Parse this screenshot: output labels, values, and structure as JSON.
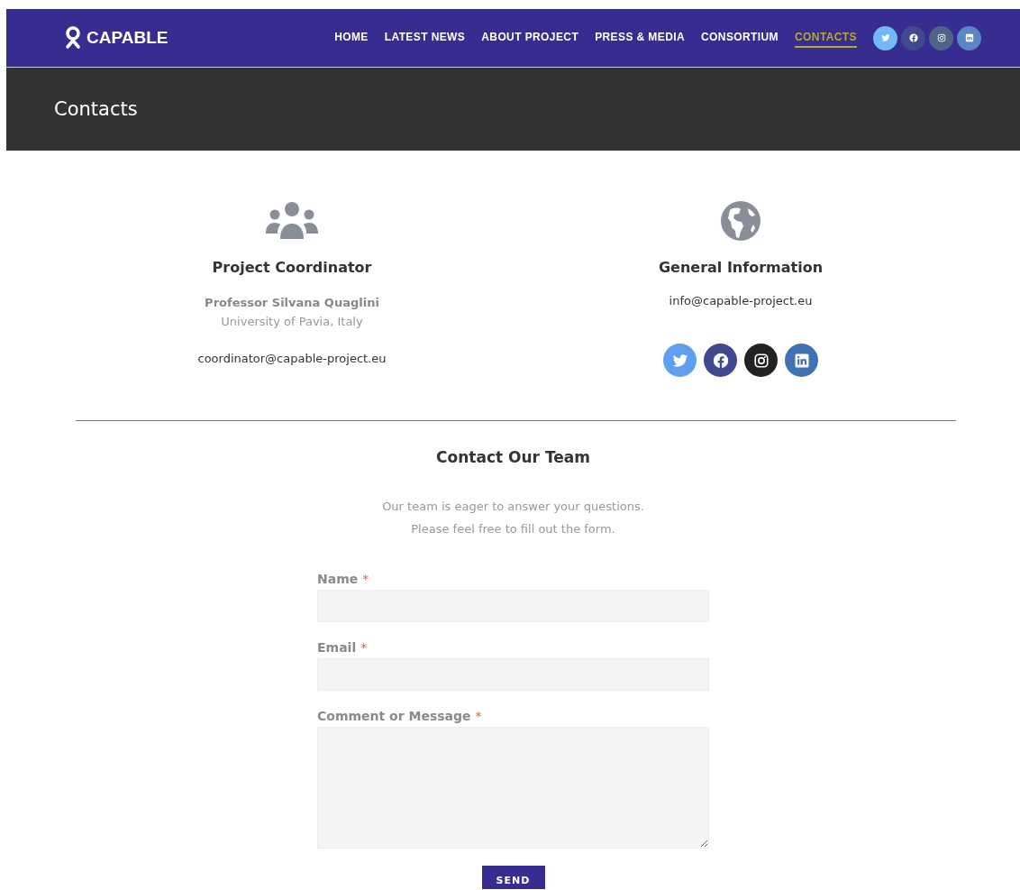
{
  "header": {
    "logo": "CAPABLE",
    "nav": [
      {
        "label": "HOME",
        "selected": false
      },
      {
        "label": "LATEST NEWS",
        "selected": false
      },
      {
        "label": "ABOUT PROJECT",
        "selected": false
      },
      {
        "label": "PRESS & MEDIA",
        "selected": false
      },
      {
        "label": "CONSORTIUM",
        "selected": false
      },
      {
        "label": "CONTACTS",
        "selected": true
      }
    ],
    "social": [
      {
        "kind": "twitter",
        "color": "#74b9f5"
      },
      {
        "kind": "facebook",
        "color": "#3f4a8e"
      },
      {
        "kind": "instagram",
        "color": "#4f6288"
      },
      {
        "kind": "linkedin",
        "color": "#5a86c6"
      }
    ]
  },
  "page_title": "Contacts",
  "contacts": [
    {
      "kind": "people",
      "heading": "Project Coordinator",
      "name": "Professor Silvana Quaglini",
      "affiliation": "University of Pavia, Italy",
      "email": "coordinator@capable-project.eu"
    },
    {
      "kind": "globe",
      "heading": "General Information",
      "email": "info@capable-project.eu",
      "social": [
        {
          "kind": "twitter",
          "color": "#5f9ff0"
        },
        {
          "kind": "facebook",
          "color": "#3d4a8f"
        },
        {
          "kind": "instagram",
          "color": "#222222"
        },
        {
          "kind": "linkedin",
          "color": "#3f71b3"
        }
      ]
    }
  ],
  "contact_form": {
    "heading": "Contact Our Team",
    "intro": [
      "Our team is eager to answer your questions.",
      "Please feel free to fill out the form."
    ],
    "fields": [
      {
        "kind": "input",
        "label": "Name",
        "required_mark": "*"
      },
      {
        "kind": "input",
        "label": "Email",
        "required_mark": "*"
      },
      {
        "kind": "textarea",
        "label": "Comment or Message",
        "required_mark": "*"
      }
    ],
    "submit": "SEND"
  }
}
